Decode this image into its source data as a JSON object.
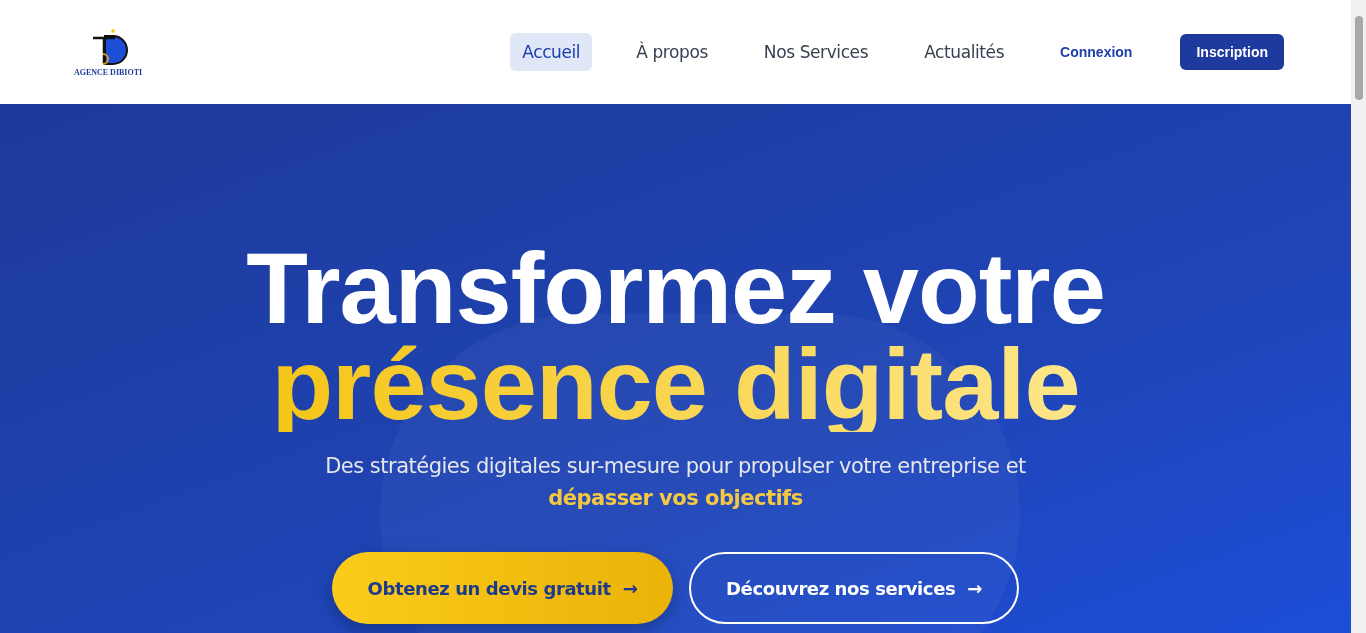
{
  "logo": {
    "caption": "AGENCE DIBIOTI"
  },
  "nav": [
    {
      "label": "Accueil",
      "selected": true
    },
    {
      "label": "À propos",
      "selected": false
    },
    {
      "label": "Nos Services",
      "selected": false
    },
    {
      "label": "Actualités",
      "selected": false
    }
  ],
  "auth": [
    {
      "label": "Connexion",
      "kind": "link"
    },
    {
      "label": "Inscription",
      "kind": "primary"
    }
  ],
  "hero": {
    "title_line1": "Transformez votre",
    "title_line2": "présence digitale",
    "subtitle": "Des stratégies digitales sur-mesure pour propulser votre entreprise et **dépasser vos objectifs**",
    "buttons": [
      {
        "label": "Obtenez un devis gratuit",
        "arrow": "→",
        "kind": "solid"
      },
      {
        "label": "Découvrez nos services",
        "arrow": "→",
        "kind": "outline"
      }
    ]
  }
}
